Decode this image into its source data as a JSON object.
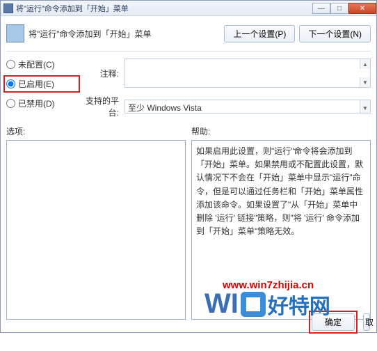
{
  "window": {
    "title": "将\"运行\"命令添加到「开始」菜单"
  },
  "header": {
    "title": "将\"运行\"命令添加到「开始」菜单",
    "prev_btn": "上一个设置(P)",
    "next_btn": "下一个设置(N)"
  },
  "radios": {
    "not_configured": "未配置(C)",
    "enabled": "已启用(E)",
    "disabled": "已禁用(D)"
  },
  "labels": {
    "comment": "注释:",
    "platform": "支持的平台:",
    "options": "选项:",
    "help": "帮助:"
  },
  "platform_value": "至少 Windows Vista",
  "help_text": "如果启用此设置，则\"运行\"命令将会添加到「开始」菜单。如果禁用或不配置此设置，默认情况下不会在「开始」菜单中显示\"运行\"命令，但是可以通过任务栏和「开始」菜单属性添加该命令。如果设置了\"从「开始」菜单中删除 '运行' 链接\"策略，则\"将 '运行' 命令添加到「开始」菜单\"策略无效。",
  "footer": {
    "ok": "确定",
    "cancel_partial": "取"
  },
  "watermark": {
    "url": "www.win7zhijia.cn",
    "text1": "WI",
    "text2": "好特网"
  }
}
